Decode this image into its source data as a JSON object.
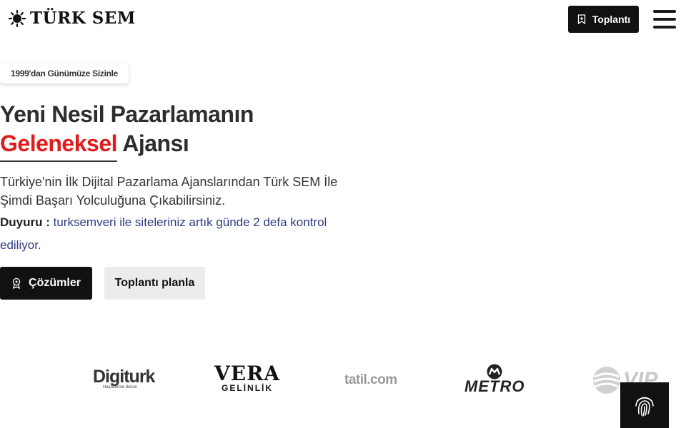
{
  "header": {
    "logo_text": "TÜRK SEM",
    "meeting_button": "Toplantı"
  },
  "hero": {
    "badge": "1999'dan Günümüze Sizinle",
    "title_line1": "Yeni Nesil Pazarlamanın",
    "title_accent": "Geleneksel",
    "title_rest": "Ajansı",
    "description": "Türkiye'nin İlk Dijital Pazarlama Ajanslarından Türk SEM İle Şimdi Başarı Yolculuğuna Çıkabilirsiniz.",
    "announcement_label": "Duyuru :",
    "announcement_text": "turksemveri ile siteleriniz artık günde 2 defa kontrol ediliyor.",
    "primary_button": "Çözümler",
    "secondary_button": "Toplantı planla"
  },
  "brands": {
    "digiturk": "Digiturk",
    "digiturk_tag": "Hayallerine dokun",
    "vera": "VERA",
    "vera_sub": "GELİNLİK",
    "tatil": "tatil.com",
    "metro": "METRO",
    "vip": "VIP"
  },
  "colors": {
    "accent": "#e01b1b",
    "dark": "#111111",
    "link": "#2f3a82"
  }
}
